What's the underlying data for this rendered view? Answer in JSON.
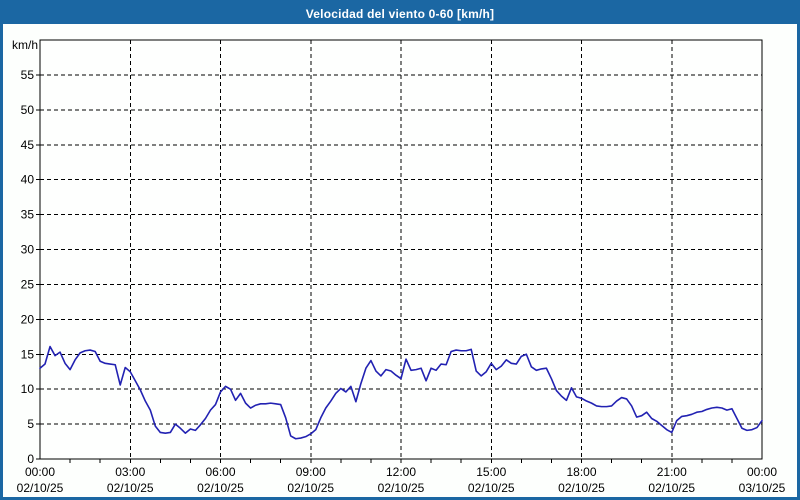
{
  "window": {
    "title": "Velocidad del viento 0-60 [km/h]"
  },
  "chart_data": {
    "type": "line",
    "title": "Velocidad del viento 0-60 [km/h]",
    "unit_label": "km/h",
    "ylim": [
      0,
      60
    ],
    "y_tick_step": 5,
    "y_tick_labels": [
      "0",
      "5",
      "10",
      "15",
      "20",
      "25",
      "30",
      "35",
      "40",
      "45",
      "50",
      "55"
    ],
    "x_range_hours": 24,
    "x_major_tick_hours": 3,
    "x_minor_tick_hours": 1,
    "grid": "dashed",
    "legend": "none",
    "x_ticks": [
      {
        "time": "00:00",
        "date": "02/10/25"
      },
      {
        "time": "03:00",
        "date": "02/10/25"
      },
      {
        "time": "06:00",
        "date": "02/10/25"
      },
      {
        "time": "09:00",
        "date": "02/10/25"
      },
      {
        "time": "12:00",
        "date": "02/10/25"
      },
      {
        "time": "15:00",
        "date": "02/10/25"
      },
      {
        "time": "18:00",
        "date": "02/10/25"
      },
      {
        "time": "21:00",
        "date": "02/10/25"
      },
      {
        "time": "00:00",
        "date": "03/10/25"
      }
    ],
    "sample_interval_minutes": 10,
    "series": [
      {
        "name": "Velocidad del viento",
        "unit": "km/h",
        "values": [
          13.0,
          13.6,
          16.1,
          14.8,
          15.3,
          13.7,
          12.8,
          14.2,
          15.2,
          15.5,
          15.6,
          15.4,
          14.0,
          13.7,
          13.6,
          13.5,
          10.6,
          13.1,
          12.5,
          11.2,
          9.9,
          8.3,
          7.0,
          4.7,
          3.8,
          3.7,
          3.8,
          5.0,
          4.4,
          3.7,
          4.3,
          4.1,
          4.9,
          5.8,
          7.0,
          7.8,
          9.6,
          10.4,
          10.0,
          8.4,
          9.4,
          8.0,
          7.3,
          7.7,
          7.9,
          7.9,
          8.0,
          7.9,
          7.8,
          5.9,
          3.3,
          2.9,
          3.0,
          3.2,
          3.6,
          4.2,
          5.9,
          7.3,
          8.3,
          9.4,
          10.1,
          9.6,
          10.4,
          8.2,
          10.8,
          13.0,
          14.1,
          12.6,
          11.9,
          12.8,
          12.6,
          12.0,
          11.5,
          14.3,
          12.7,
          12.8,
          13.0,
          11.2,
          13.0,
          12.7,
          13.6,
          13.5,
          15.4,
          15.6,
          15.5,
          15.5,
          15.7,
          12.6,
          11.9,
          12.5,
          13.7,
          12.8,
          13.3,
          14.2,
          13.7,
          13.6,
          14.7,
          15.0,
          13.2,
          12.7,
          12.9,
          13.0,
          11.5,
          9.8,
          9.0,
          8.4,
          10.2,
          8.9,
          8.7,
          8.3,
          8.0,
          7.6,
          7.5,
          7.5,
          7.6,
          8.3,
          8.8,
          8.6,
          7.6,
          6.0,
          6.2,
          6.7,
          5.8,
          5.4,
          4.8,
          4.2,
          3.8,
          5.5,
          6.1,
          6.2,
          6.4,
          6.7,
          6.8,
          7.1,
          7.3,
          7.4,
          7.3,
          7.0,
          7.2,
          5.8,
          4.4,
          4.1,
          4.2,
          4.5,
          5.5
        ]
      }
    ],
    "colors": {
      "titlebar": "#1b67a3",
      "border": "#1b67a3",
      "line": "#2222b2",
      "grid": "#000000",
      "axis": "#000000",
      "background": "#fdfffd",
      "text": "#000000"
    }
  }
}
